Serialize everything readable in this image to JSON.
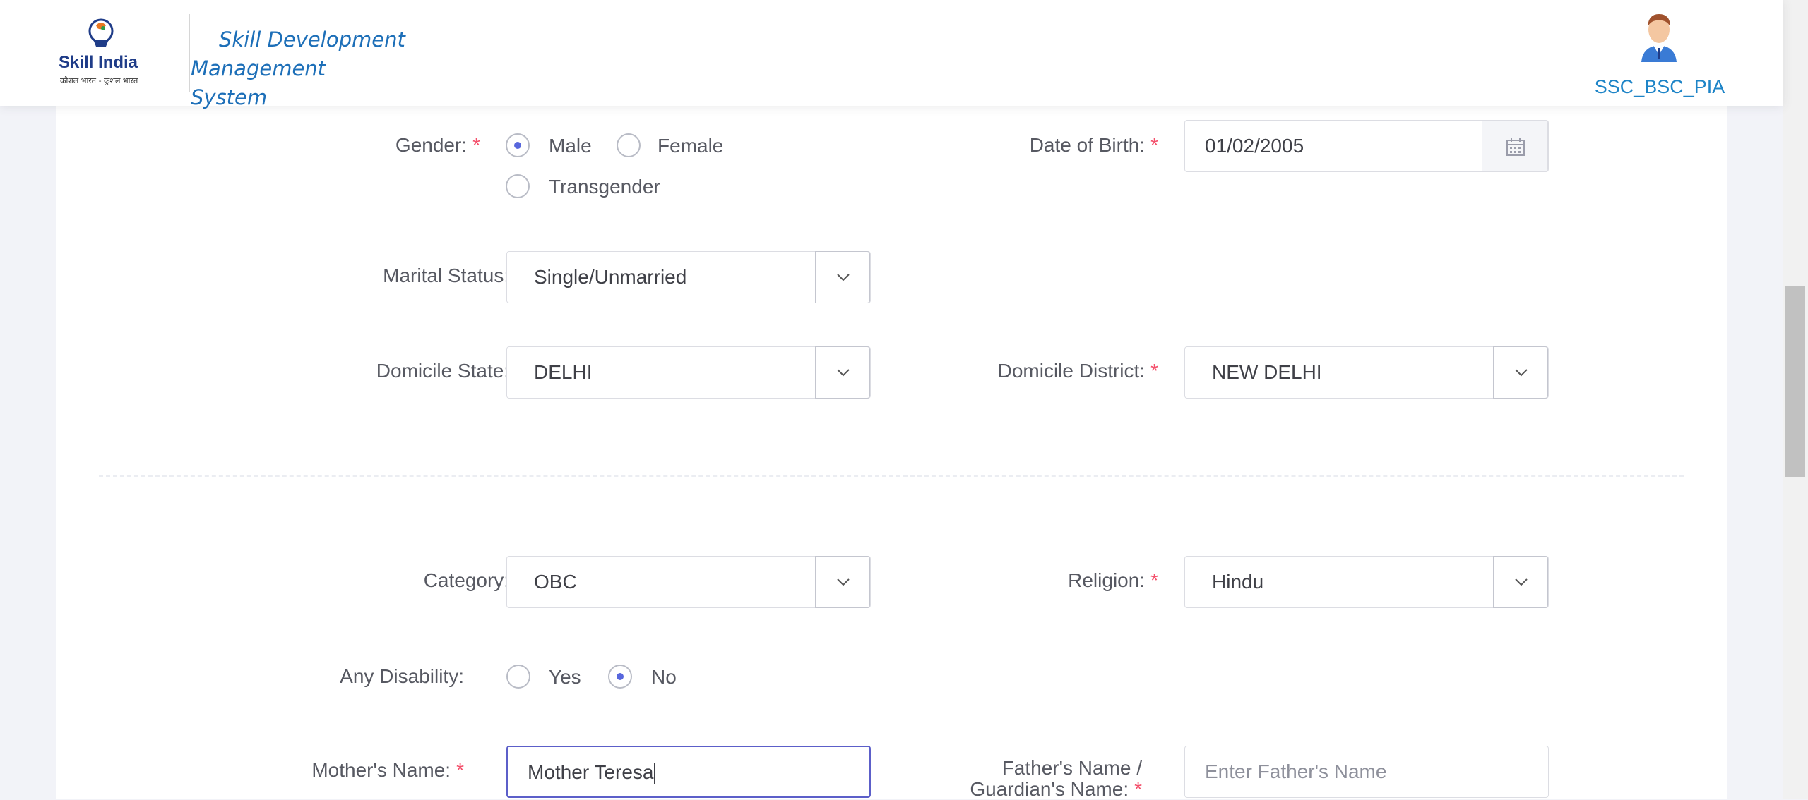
{
  "header": {
    "brand_title_line1": "Skill Development Management",
    "brand_title_line2": "System",
    "logo_text": "Skill India",
    "logo_tagline": "कौशल भारत - कुशल भारत",
    "user_name": "SSC_BSC_PIA"
  },
  "form": {
    "gender": {
      "label": "Gender:",
      "options": [
        "Male",
        "Female",
        "Transgender"
      ],
      "selected": "Male"
    },
    "date_of_birth": {
      "label": "Date of Birth:",
      "value": "01/02/2005"
    },
    "marital_status": {
      "label": "Marital Status:",
      "value": "Single/Unmarried"
    },
    "domicile_state": {
      "label": "Domicile State:",
      "value": "DELHI"
    },
    "domicile_district": {
      "label": "Domicile District:",
      "value": "NEW DELHI"
    },
    "category": {
      "label": "Category:",
      "value": "OBC"
    },
    "religion": {
      "label": "Religion:",
      "value": "Hindu"
    },
    "any_disability": {
      "label": "Any Disability:",
      "options": [
        "Yes",
        "No"
      ],
      "selected": "No"
    },
    "mothers_name": {
      "label": "Mother's Name:",
      "value": "Mother Teresa"
    },
    "fathers_name": {
      "label_line1": "Father's Name /",
      "label_line2": "Guardian's Name:",
      "placeholder": "Enter Father's Name"
    },
    "required_mark": "*"
  },
  "colors": {
    "accent": "#5867dd",
    "brand_blue": "#1d6fb8",
    "required": "#f4516c"
  },
  "icons": {
    "date_picker": "calendar-icon",
    "select_toggle": "chevron-down-icon",
    "user": "avatar-icon"
  }
}
